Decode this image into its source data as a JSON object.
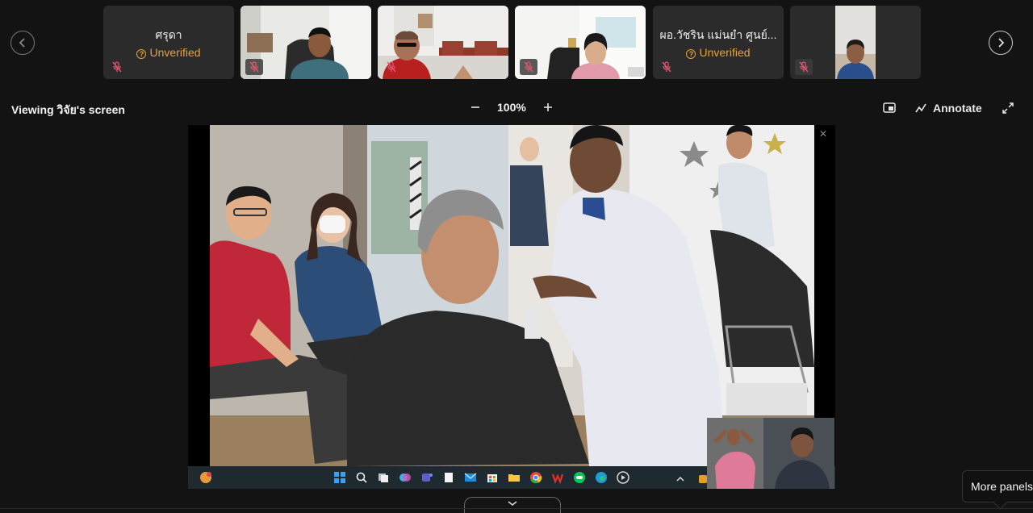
{
  "strip": {
    "prev_icon": "chevron-left-icon",
    "next_icon": "chevron-right-icon",
    "participants": [
      {
        "name": "ศรุดา",
        "status": "Unverified",
        "type": "avatar-name"
      },
      {
        "name": "",
        "status": "",
        "type": "video"
      },
      {
        "name": "",
        "status": "",
        "type": "video"
      },
      {
        "name": "",
        "status": "",
        "type": "video"
      },
      {
        "name": "ผอ.วัชริน แม่นยำ ศูนย์...",
        "status": "Unverified",
        "type": "avatar-name"
      },
      {
        "name": "",
        "status": "",
        "type": "video"
      }
    ]
  },
  "toolbar": {
    "viewing": "Viewing วิจัย's screen",
    "zoom_level": "100%",
    "annotate": "Annotate"
  },
  "bottom": {
    "more_panels": "More panels"
  },
  "colors": {
    "background": "#131313",
    "tile": "#2b2b2b",
    "unverified": "#e8a13a",
    "muted_red": "#e0556e"
  }
}
